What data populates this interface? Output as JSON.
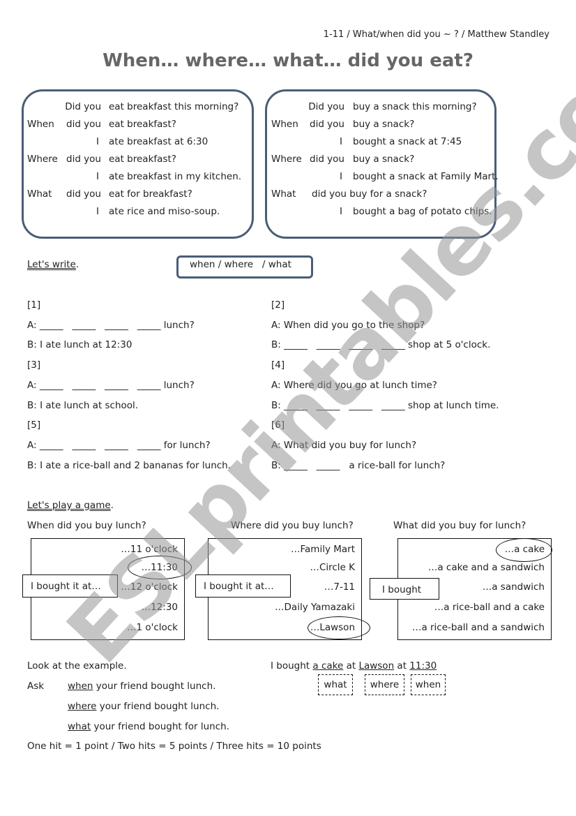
{
  "header": {
    "credit": "1-11 / What/when did you ~ ? / Matthew Standley",
    "title": "When… where… what… did you eat?"
  },
  "box_breakfast": {
    "rows": [
      {
        "wh": "",
        "aux": "Did you",
        "rest": "eat breakfast this morning?"
      },
      {
        "wh": "When",
        "aux": "did you",
        "rest": "eat breakfast?"
      },
      {
        "wh": "",
        "aux": "I",
        "rest": "ate breakfast at 6:30"
      },
      {
        "wh": "Where",
        "aux": "did you",
        "rest": "eat breakfast?"
      },
      {
        "wh": "",
        "aux": "I",
        "rest": "ate breakfast in my kitchen."
      },
      {
        "wh": "What",
        "aux": "did you",
        "rest": "eat for breakfast?"
      },
      {
        "wh": "",
        "aux": "I",
        "rest": "ate rice and miso-soup."
      }
    ]
  },
  "box_snack": {
    "rows": [
      {
        "wh": "",
        "aux": "Did you",
        "rest": "buy a snack this morning?"
      },
      {
        "wh": "When",
        "aux": "did you",
        "rest": "buy a snack?"
      },
      {
        "wh": "",
        "aux": "I",
        "rest": "bought a snack at 7:45"
      },
      {
        "wh": "Where",
        "aux": "did you",
        "rest": "buy a snack?"
      },
      {
        "wh": "",
        "aux": "I",
        "rest": "bought a snack at Family Mart."
      },
      {
        "wh": "What",
        "aux": "did you buy for a snack?",
        "rest": ""
      },
      {
        "wh": "",
        "aux": "I",
        "rest": "bought a bag of potato chips."
      }
    ]
  },
  "write_section": {
    "heading": "Let's write",
    "heading_suffix": ".",
    "word_bank": "when / where   / what",
    "exercises": [
      {
        "num": "[1]",
        "a": "A: _____   _____   _____   _____ lunch?",
        "b": "B: I ate lunch at 12:30"
      },
      {
        "num": "[2]",
        "a": "A: When did you go to the shop?",
        "b": "B: _____   _____   _____   _____ shop at 5 o'clock."
      },
      {
        "num": "[3]",
        "a": "A: _____   _____   _____   _____ lunch?",
        "b": "B: I ate lunch at school."
      },
      {
        "num": "[4]",
        "a": "A: Where did you go at lunch time?",
        "b": "B: _____   _____   _____   _____ shop at lunch time."
      },
      {
        "num": "[5]",
        "a": "A: _____   _____   _____   _____ for lunch?",
        "b": "B: I ate a rice-ball and 2 bananas for lunch."
      },
      {
        "num": "[6]",
        "a": "A: What did you buy for lunch?",
        "b": "B: _____   _____   a rice-ball for lunch?"
      }
    ]
  },
  "game_section": {
    "heading": "Let's play a game",
    "heading_suffix": ".",
    "panels": [
      {
        "question": "When did you buy lunch?",
        "tag": "I bought it at…",
        "options": [
          "…11 o'clock",
          "…11:30",
          "…12 o'clock",
          "…12:30",
          "…1 o'clock"
        ],
        "circled": "…11:30"
      },
      {
        "question": "Where did you buy lunch?",
        "tag": "I bought it at…",
        "options": [
          "…Family Mart",
          "…Circle K",
          "…7-11",
          "…Daily Yamazaki",
          "…Lawson"
        ],
        "circled": "…Lawson"
      },
      {
        "question": "What did you buy for lunch?",
        "tag": "I bought",
        "options": [
          "…a cake",
          "…a cake and a sandwich",
          "…a sandwich",
          "…a rice-ball and a cake",
          "…a rice-ball and a sandwich"
        ],
        "circled": "…a cake"
      }
    ]
  },
  "instructions": {
    "look": "Look at the example.",
    "ask": "Ask",
    "lines": [
      {
        "key": "when",
        "rest": " your friend bought lunch."
      },
      {
        "key": "where",
        "rest": " your friend bought lunch."
      },
      {
        "key": "what",
        "rest": " your friend bought for lunch."
      }
    ],
    "scoring": "One hit = 1 point / Two hits = 5 points / Three hits = 10 points"
  },
  "example": {
    "prefix": "I bought ",
    "what": "a cake",
    "mid1": " at ",
    "where": "Lawson",
    "mid2": " at ",
    "when": "11:30",
    "labels": [
      "what",
      "where",
      "when"
    ]
  },
  "watermark": "ESLprintables.com"
}
